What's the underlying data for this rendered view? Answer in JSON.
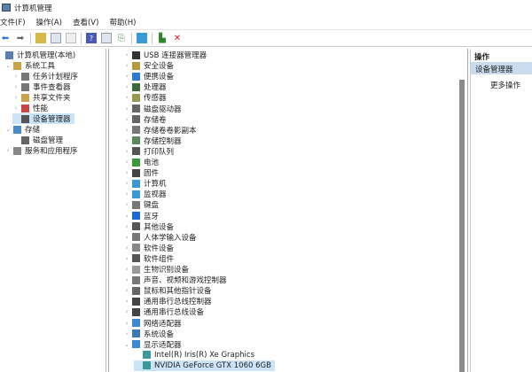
{
  "window": {
    "title": "计算机管理"
  },
  "menu": [
    "文件(F)",
    "操作(A)",
    "查看(V)",
    "帮助(H)"
  ],
  "toolbar": {
    "icons": [
      "back-icon",
      "forward-icon",
      "up-icon",
      "show-hide-tree-icon",
      "properties-icon",
      "help-icon",
      "view-icon",
      "export-icon",
      "monitor-icon",
      "enable-device-icon",
      "uninstall-icon"
    ]
  },
  "tree": [
    {
      "label": "计算机管理(本地)",
      "level": 0,
      "chev": "",
      "icon": "#5a7fb0"
    },
    {
      "label": "系统工具",
      "level": 1,
      "chev": "⌄",
      "icon": "#c9a34a"
    },
    {
      "label": "任务计划程序",
      "level": 2,
      "chev": "›",
      "icon": "#777"
    },
    {
      "label": "事件查看器",
      "level": 2,
      "chev": "›",
      "icon": "#777"
    },
    {
      "label": "共享文件夹",
      "level": 2,
      "chev": "›",
      "icon": "#c9a34a"
    },
    {
      "label": "性能",
      "level": 2,
      "chev": "›",
      "icon": "#c44"
    },
    {
      "label": "设备管理器",
      "level": 2,
      "chev": "",
      "icon": "#555",
      "selected": true
    },
    {
      "label": "存储",
      "level": 1,
      "chev": "⌄",
      "icon": "#4a8bc9"
    },
    {
      "label": "磁盘管理",
      "level": 2,
      "chev": "",
      "icon": "#666"
    },
    {
      "label": "服务和应用程序",
      "level": 1,
      "chev": "›",
      "icon": "#888"
    }
  ],
  "devices": [
    {
      "label": "USB 连接器管理器",
      "icon": "#333",
      "chev": "›"
    },
    {
      "label": "安全设备",
      "icon": "#b89a3a",
      "chev": "›"
    },
    {
      "label": "便携设备",
      "icon": "#2a7bd5",
      "chev": "›"
    },
    {
      "label": "处理器",
      "icon": "#3a6a3a",
      "chev": "›"
    },
    {
      "label": "传感器",
      "icon": "#9a9a4a",
      "chev": "›"
    },
    {
      "label": "磁盘驱动器",
      "icon": "#666",
      "chev": "›"
    },
    {
      "label": "存储卷",
      "icon": "#666",
      "chev": "›"
    },
    {
      "label": "存储卷卷影副本",
      "icon": "#777",
      "chev": "›"
    },
    {
      "label": "存储控制器",
      "icon": "#5a8a5a",
      "chev": "›"
    },
    {
      "label": "打印队列",
      "icon": "#555",
      "chev": "›"
    },
    {
      "label": "电池",
      "icon": "#3a9a3a",
      "chev": "›"
    },
    {
      "label": "固件",
      "icon": "#444",
      "chev": "›"
    },
    {
      "label": "计算机",
      "icon": "#3a9ad5",
      "chev": "›"
    },
    {
      "label": "监视器",
      "icon": "#3a9ad5",
      "chev": "›"
    },
    {
      "label": "键盘",
      "icon": "#777",
      "chev": "›"
    },
    {
      "label": "蓝牙",
      "icon": "#1a6ad5",
      "chev": "›"
    },
    {
      "label": "其他设备",
      "icon": "#555",
      "chev": "›"
    },
    {
      "label": "人体学输入设备",
      "icon": "#777",
      "chev": "›"
    },
    {
      "label": "软件设备",
      "icon": "#888",
      "chev": "›"
    },
    {
      "label": "软件组件",
      "icon": "#555",
      "chev": "›"
    },
    {
      "label": "生物识别设备",
      "icon": "#999",
      "chev": "›"
    },
    {
      "label": "声音、视频和游戏控制器",
      "icon": "#777",
      "chev": "›"
    },
    {
      "label": "鼠标和其他指针设备",
      "icon": "#666",
      "chev": "›"
    },
    {
      "label": "通用串行总线控制器",
      "icon": "#444",
      "chev": "›"
    },
    {
      "label": "通用串行总线设备",
      "icon": "#444",
      "chev": "›"
    },
    {
      "label": "网络适配器",
      "icon": "#3a8ad5",
      "chev": "›"
    },
    {
      "label": "系统设备",
      "icon": "#3a7ab5",
      "chev": "›"
    },
    {
      "label": "显示适配器",
      "icon": "#3a8ad5",
      "chev": "⌄"
    },
    {
      "label": "Intel(R) Iris(R) Xe Graphics",
      "icon": "#3a9a9a",
      "chev": "",
      "child": true
    },
    {
      "label": "NVIDIA GeForce GTX 1060 6GB",
      "icon": "#3a9a9a",
      "chev": "",
      "child": true,
      "selected": true
    }
  ],
  "actions": {
    "header": "操作",
    "selected": "设备管理器",
    "more": "更多操作"
  }
}
